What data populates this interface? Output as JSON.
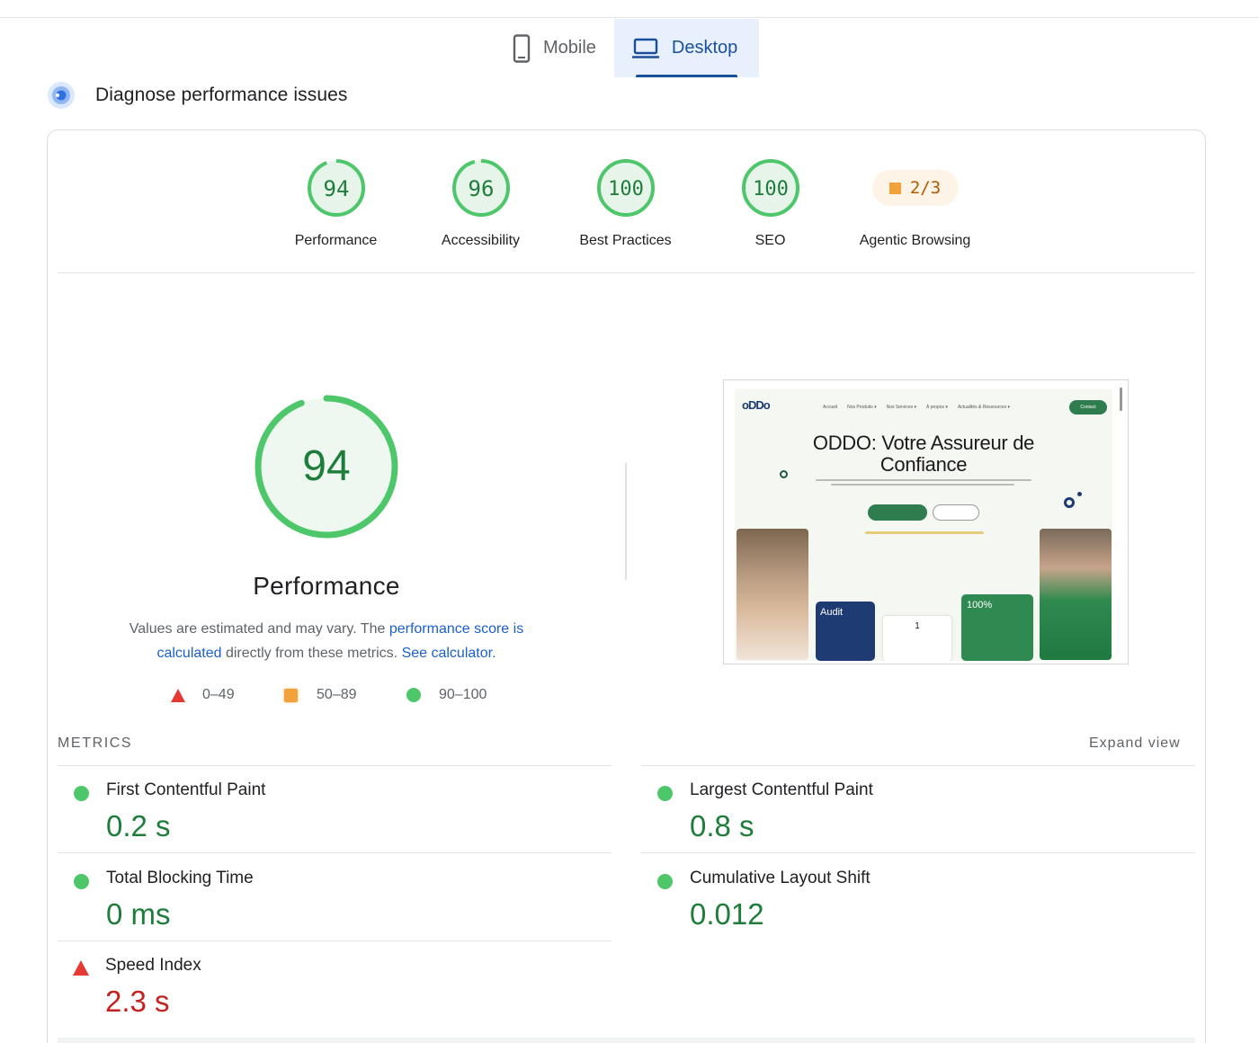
{
  "tabs": [
    {
      "label": "Mobile",
      "icon": "phone-icon",
      "active": false
    },
    {
      "label": "Desktop",
      "icon": "laptop-icon",
      "active": true
    }
  ],
  "section": {
    "title": "Diagnose performance issues",
    "icon": "diagnose-icon"
  },
  "summary": [
    {
      "label": "Performance",
      "score": "94",
      "pct": 94
    },
    {
      "label": "Accessibility",
      "score": "96",
      "pct": 96
    },
    {
      "label": "Best Practices",
      "score": "100",
      "pct": 100
    },
    {
      "label": "SEO",
      "score": "100",
      "pct": 100
    },
    {
      "label": "Agentic Browsing",
      "score": "2/3",
      "style": "pill"
    }
  ],
  "performance": {
    "score": "94",
    "pct": 94,
    "title": "Performance",
    "note_prefix": "Values are estimated and may vary. The ",
    "note_link1": "performance score is calculated",
    "note_middle": " directly from these metrics. ",
    "note_link2": "See calculator.",
    "legend": [
      {
        "range": "0–49",
        "shape": "triangle",
        "color": "#e53935"
      },
      {
        "range": "50–89",
        "shape": "square",
        "color": "#f2a13b"
      },
      {
        "range": "90–100",
        "shape": "circle",
        "color": "#4ec66a"
      }
    ]
  },
  "screenshot": {
    "logo": "oDDo",
    "nav": [
      "Accueil",
      "Nos Produits ▾",
      "Nos Services ▾",
      "À propos ▾",
      "Actualités & Ressources ▾"
    ],
    "contact": "Contact",
    "title": "ODDO: Votre Assureur de Confiance",
    "card_audit": "Audit",
    "card_mid": "1",
    "card_green": "100%"
  },
  "metrics": {
    "header": "METRICS",
    "expand": "Expand view",
    "items": [
      {
        "name": "First Contentful Paint",
        "value": "0.2 s",
        "status": "good"
      },
      {
        "name": "Largest Contentful Paint",
        "value": "0.8 s",
        "status": "good"
      },
      {
        "name": "Total Blocking Time",
        "value": "0 ms",
        "status": "good"
      },
      {
        "name": "Cumulative Layout Shift",
        "value": "0.012",
        "status": "good"
      },
      {
        "name": "Speed Index",
        "value": "2.3 s",
        "status": "bad"
      }
    ]
  },
  "colors": {
    "good": "#4ec66a",
    "good_text": "#1e7d3a",
    "good_fill": "#e6f4ea",
    "bad": "#e53935",
    "average": "#f2a13b",
    "accent": "#1a4f9c"
  }
}
